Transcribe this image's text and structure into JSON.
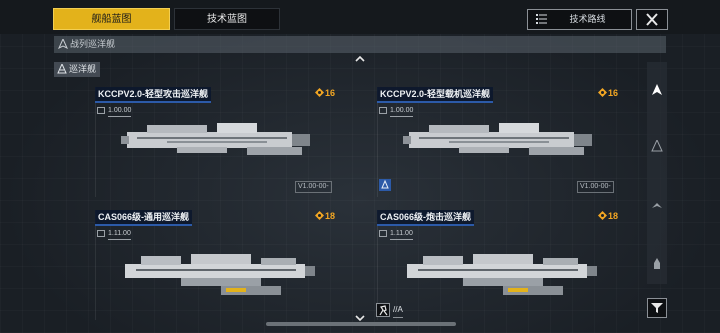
{
  "tabs": {
    "active_label": "舰船蓝图",
    "other_label": "技术蓝图"
  },
  "header": {
    "tech_route_label": "技术路线",
    "close_icon": "close-icon"
  },
  "breadcrumb": {
    "label": "战列巡洋舰"
  },
  "category": {
    "label": "巡洋舰"
  },
  "cards": [
    {
      "name": "KCCPV2.0-轻型攻击巡洋舰",
      "cost": "16",
      "level": "1.00.00",
      "version": "V1.00-00-",
      "has_badge": false
    },
    {
      "name": "KCCPV2.0-轻型载机巡洋舰",
      "cost": "16",
      "level": "1.00.00",
      "version": "V1.00-00-",
      "has_badge": true
    },
    {
      "name": "CAS066级-通用巡洋舰",
      "cost": "18",
      "level": "1.11.00",
      "version": "",
      "has_badge": false
    },
    {
      "name": "CAS066级-炮击巡洋舰",
      "cost": "18",
      "level": "1.11.00",
      "version": "",
      "has_badge": false
    }
  ],
  "bottom": {
    "tag_label": "//A"
  },
  "colors": {
    "accent": "#e3b21b",
    "cost": "#f2a623",
    "name_bar": "#2c5aa8"
  }
}
